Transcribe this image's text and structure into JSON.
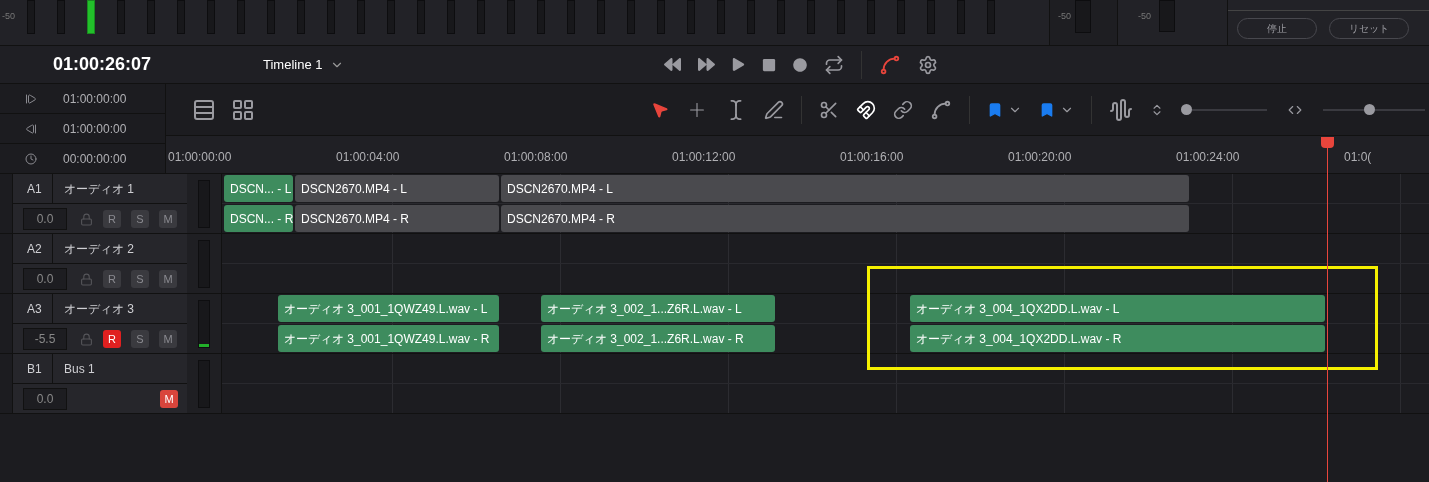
{
  "meter_bridge": {
    "scale_labels": [
      "-50",
      "-50",
      "-50"
    ],
    "buttons": [
      "停止",
      "リセット"
    ]
  },
  "timecode": "01:00:26:07",
  "timeline_name": "Timeline 1",
  "timecode_fields": [
    {
      "kind": "in",
      "value": "01:00:00:00"
    },
    {
      "kind": "out",
      "value": "01:00:00:00"
    },
    {
      "kind": "duration",
      "value": "00:00:00:00"
    }
  ],
  "toolbar": {
    "tools": [
      {
        "kind": "pointer",
        "selected": true
      },
      {
        "kind": "trim",
        "selected": false
      },
      {
        "kind": "blade-range",
        "selected": false
      },
      {
        "kind": "pen",
        "selected": false
      }
    ],
    "snapping": true,
    "sliders": [
      {
        "kind": "height",
        "level": 0
      },
      {
        "kind": "zoom",
        "level": 0.45
      }
    ]
  },
  "ruler": [
    "01:00:00:00",
    "01:00:04:00",
    "01:00:08:00",
    "01:00:12:00",
    "01:00:16:00",
    "01:00:20:00",
    "01:00:24:00",
    "01:0("
  ],
  "tracks": [
    {
      "kind": "audio",
      "id": "A1",
      "name": "オーディオ 1",
      "volume": "0.0",
      "controls": [
        {
          "kind": "record",
          "label": "R",
          "on": false
        },
        {
          "kind": "solo",
          "label": "S",
          "on": false
        },
        {
          "kind": "mute",
          "label": "M",
          "on": false
        }
      ],
      "lanes": [
        [
          {
            "label": "DSCN... - L",
            "color": "#3e8c5e"
          },
          {
            "label": "DSCN2670.MP4 - L",
            "color": "#4a4a4e"
          },
          {
            "label": "DSCN2670.MP4 - L",
            "color": "#4a4a4e"
          }
        ],
        [
          {
            "label": "DSCN... - R",
            "color": "#3e8c5e"
          },
          {
            "label": "DSCN2670.MP4 - R",
            "color": "#4a4a4e"
          },
          {
            "label": "DSCN2670.MP4 - R",
            "color": "#4a4a4e"
          }
        ]
      ]
    },
    {
      "kind": "audio",
      "id": "A2",
      "name": "オーディオ 2",
      "volume": "0.0",
      "controls": [
        {
          "kind": "record",
          "label": "R",
          "on": false
        },
        {
          "kind": "solo",
          "label": "S",
          "on": false
        },
        {
          "kind": "mute",
          "label": "M",
          "on": false
        }
      ]
    },
    {
      "kind": "audio",
      "id": "A3",
      "name": "オーディオ 3",
      "volume": "-5.5",
      "controls": [
        {
          "kind": "record",
          "label": "R",
          "on": true
        },
        {
          "kind": "solo",
          "label": "S",
          "on": false
        },
        {
          "kind": "mute",
          "label": "M",
          "on": false
        }
      ],
      "level": 0.06,
      "lanes": [
        [
          {
            "label": "オーディオ 3_001_1QWZ49.L.wav - L",
            "color": "#3e8c5e"
          },
          {
            "label": "オーディオ 3_002_1...Z6R.L.wav - L",
            "color": "#3e8c5e"
          },
          {
            "label": "オーディオ 3_004_1QX2DD.L.wav - L",
            "color": "#3e8c5e"
          }
        ],
        [
          {
            "label": "オーディオ 3_001_1QWZ49.L.wav - R",
            "color": "#3e8c5e"
          },
          {
            "label": "オーディオ 3_002_1...Z6R.L.wav - R",
            "color": "#3e8c5e"
          },
          {
            "label": "オーディオ 3_004_1QX2DD.L.wav - R",
            "color": "#3e8c5e"
          }
        ]
      ]
    },
    {
      "kind": "bus",
      "id": "B1",
      "name": "Bus 1",
      "volume": "0.0",
      "controls": [
        {
          "kind": "mute",
          "label": "M",
          "on": true
        }
      ]
    }
  ]
}
